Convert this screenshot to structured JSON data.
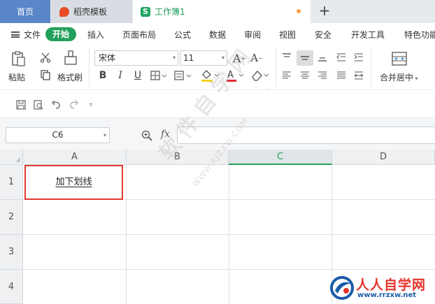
{
  "tabs": [
    {
      "label": "首页"
    },
    {
      "label": "稻壳模板"
    },
    {
      "label": "工作簿1",
      "unsaved_dot": true
    }
  ],
  "menu": {
    "file": "文件",
    "active": "开始",
    "items": [
      "插入",
      "页面布局",
      "公式",
      "数据",
      "审阅",
      "视图",
      "安全",
      "开发工具",
      "特色功能"
    ]
  },
  "ribbon": {
    "paste": "粘贴",
    "format_painter": "格式刷",
    "font_name": "宋体",
    "font_size": "11",
    "merge_center": "合并居中"
  },
  "name_box": {
    "value": "C6"
  },
  "formula_bar": {
    "fx_label": "fx",
    "value": ""
  },
  "sheet": {
    "columns": [
      "A",
      "B",
      "C",
      "D"
    ],
    "active_column": "C",
    "rows": [
      "1",
      "2",
      "3",
      "4"
    ],
    "cell_a1": "加下划线"
  },
  "watermark": {
    "text": "软件自学网",
    "url": "WWW.RJZXW.COM"
  },
  "logo": {
    "name": "人人自学网",
    "url": "www.rrzxw.net"
  },
  "colors": {
    "accent_green": "#23a15a",
    "tab_blue": "#5b86c8",
    "selection_red": "#e0392f"
  }
}
